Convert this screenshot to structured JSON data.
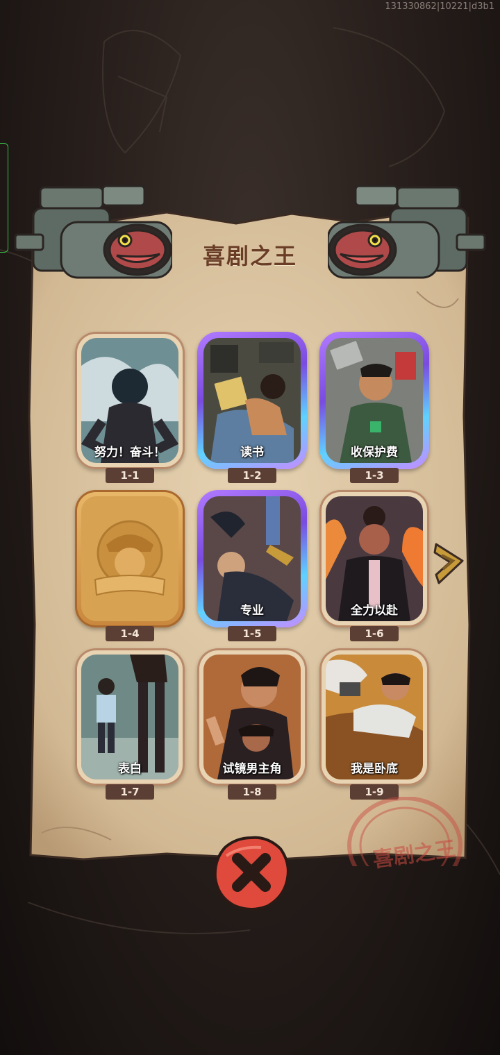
{
  "build_id": "131330862|10221|d3b1",
  "title": "喜剧之王",
  "stamp_text": "喜剧之王",
  "levels": [
    {
      "id": "1-1",
      "label": "努力！奋斗！",
      "state": "normal"
    },
    {
      "id": "1-2",
      "label": "读书",
      "state": "purple"
    },
    {
      "id": "1-3",
      "label": "收保护费",
      "state": "purple"
    },
    {
      "id": "1-4",
      "label": "",
      "state": "locked"
    },
    {
      "id": "1-5",
      "label": "专业",
      "state": "purple"
    },
    {
      "id": "1-6",
      "label": "全力以赴",
      "state": "normal"
    },
    {
      "id": "1-7",
      "label": "表白",
      "state": "normal"
    },
    {
      "id": "1-8",
      "label": "试镜男主角",
      "state": "normal"
    },
    {
      "id": "1-9",
      "label": "我是卧底",
      "state": "normal"
    }
  ],
  "icons": {
    "next": "next-arrow-icon",
    "close": "close-icon",
    "camera": "camera-icon",
    "lock": "locked-card-icon"
  },
  "colors": {
    "paper": "#d8c2a3",
    "title": "#6a3e26",
    "close_button": "#e04a3c",
    "badge": "#5b3e34",
    "purple_frame": "#9a5cf0"
  }
}
